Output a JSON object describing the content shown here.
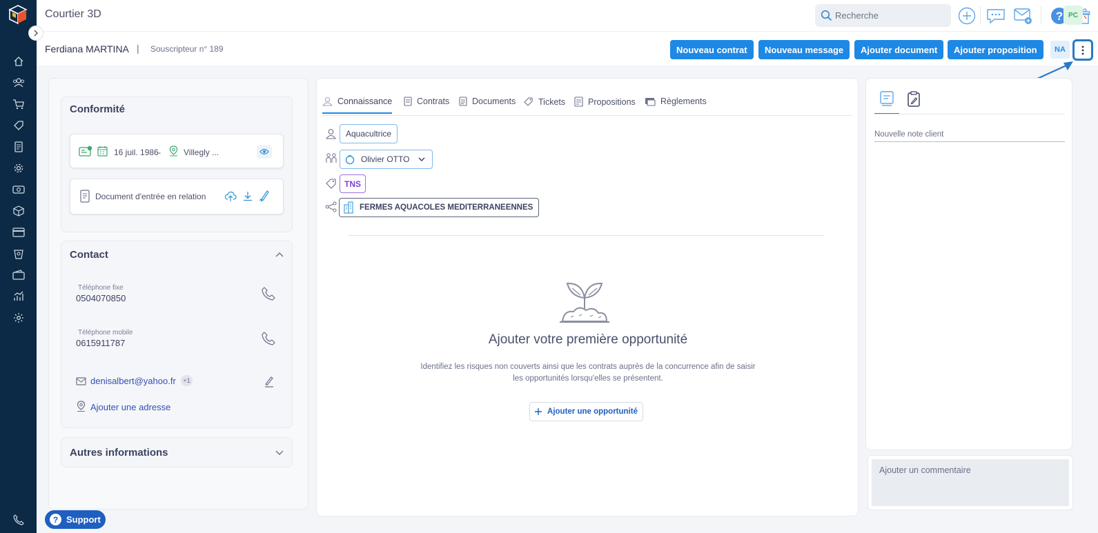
{
  "app": {
    "title": "Courtier 3D"
  },
  "search": {
    "placeholder": "Recherche"
  },
  "user": {
    "initials": "PC"
  },
  "client": {
    "name": "Ferdiana MARTINA",
    "separator": "|",
    "subtitle": "Souscripteur n° 189"
  },
  "actions": {
    "new_contract": "Nouveau contrat",
    "new_message": "Nouveau message",
    "add_document": "Ajouter document",
    "add_proposal": "Ajouter proposition",
    "na_badge": "NA"
  },
  "sidebar": {
    "items": [
      "home-icon",
      "users-icon",
      "cart-icon",
      "tag-icon",
      "document-icon",
      "settings-gear-icon",
      "money-icon",
      "box-icon",
      "card-icon",
      "receipt-icon",
      "wallet-icon",
      "chart-icon",
      "config-icon",
      "phone-icon"
    ]
  },
  "conformite": {
    "title": "Conformité",
    "birth_date": "16 juil. 1986",
    "dash": "-",
    "birth_place": "Villegly ...",
    "doc_label": "Document d'entrée en relation"
  },
  "contact": {
    "title": "Contact",
    "fixe_label": "Téléphone fixe",
    "fixe_value": "0504070850",
    "mobile_label": "Téléphone mobile",
    "mobile_value": "0615911787",
    "email": "denisalbert@yahoo.fr",
    "email_extra": "+1",
    "add_address": "Ajouter une adresse"
  },
  "autres": {
    "title": "Autres informations"
  },
  "support": {
    "label": "Support"
  },
  "tabs": [
    {
      "label": "Connaissance",
      "icon": "knowledge-icon"
    },
    {
      "label": "Contrats",
      "icon": "contract-icon"
    },
    {
      "label": "Documents",
      "icon": "document-icon"
    },
    {
      "label": "Tickets",
      "icon": "ticket-icon"
    },
    {
      "label": "Propositions",
      "icon": "proposal-icon"
    },
    {
      "label": "Règlements",
      "icon": "payment-icon"
    }
  ],
  "knowledge": {
    "profession": "Aquacultrice",
    "relation": "Olivier OTTO",
    "status": "TNS",
    "company": "FERMES AQUACOLES MEDITERRANEENNES"
  },
  "empty_state": {
    "title": "Ajouter votre première opportunité",
    "desc_line1": "Identifiez les risques non couverts ainsi que les contrats auprès de la concurrence afin de saisir",
    "desc_line2": "les opportunités lorsqu'elles se présentent.",
    "button": "Ajouter une opportunité"
  },
  "notes": {
    "placeholder": "Nouvelle note client",
    "comment_placeholder": "Ajouter un commentaire"
  },
  "colors": {
    "sidebar": "#0c2a45",
    "primary": "#1e88e5",
    "accent_purple": "#7b43d6",
    "support": "#1e5fbf"
  }
}
